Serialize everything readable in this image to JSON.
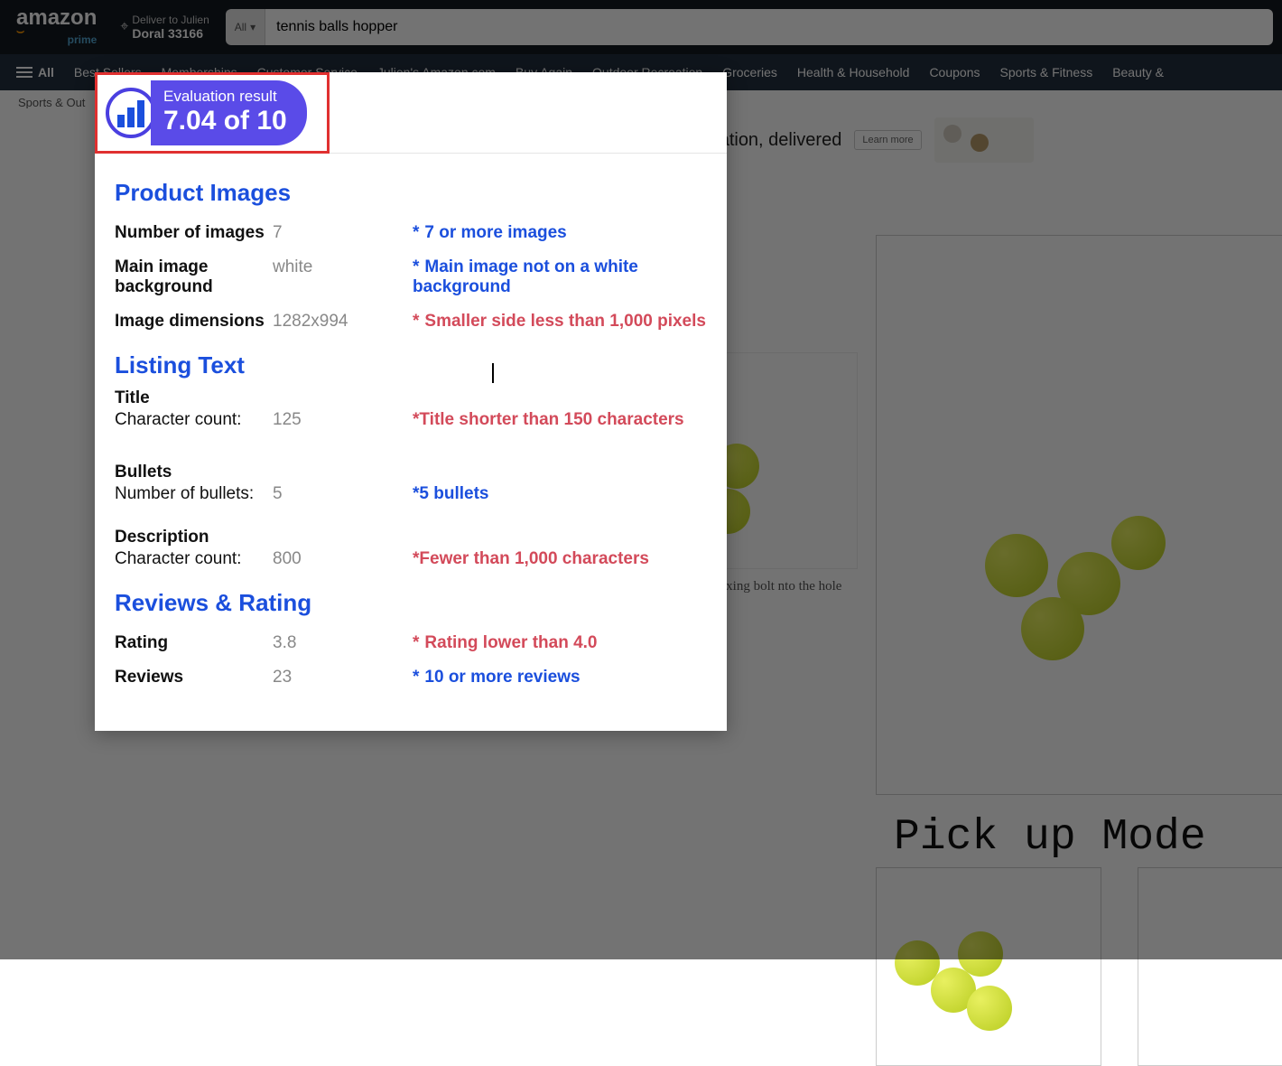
{
  "header": {
    "logo_main": "amazon",
    "logo_sub": "prime",
    "deliver_label": "Deliver to Julien",
    "deliver_loc": "Doral 33166",
    "search_cat": "All",
    "search_value": "tennis balls hopper"
  },
  "nav": {
    "all": "All",
    "items": [
      "Best Sellers",
      "Memberships",
      "Customer Service",
      "Julien's Amazon.com",
      "Buy Again",
      "Outdoor Recreation",
      "Groceries",
      "Health & Household",
      "Coupons",
      "Sports & Fitness",
      "Beauty &"
    ]
  },
  "breadcrumb": "Sports & Out",
  "bg": {
    "banner_text": "ur medication, delivered",
    "banner_cta": "Learn more",
    "caption": "nsert the fixing bolt nto the hole",
    "mode_title": "Pick up Mode"
  },
  "panel": {
    "badge_label": "Evaluation result",
    "badge_score": "7.04 of 10",
    "sections": {
      "images": {
        "title": "Product Images",
        "rows": [
          {
            "label": "Number of images",
            "value": "7",
            "note": "7 or more images",
            "status": "pass"
          },
          {
            "label": "Main image background",
            "value": "white",
            "note": "Main image not on a white background",
            "status": "pass"
          },
          {
            "label": "Image dimensions",
            "value": "1282x994",
            "note": "Smaller side less than 1,000 pixels",
            "status": "fail"
          }
        ]
      },
      "listing": {
        "title": "Listing Text",
        "groups": [
          {
            "head": "Title",
            "label": "Character count:",
            "value": "125",
            "note": "Title shorter than 150 characters",
            "status": "fail"
          },
          {
            "head": "Bullets",
            "label": "Number of bullets:",
            "value": "5",
            "note": "5 bullets",
            "status": "pass"
          },
          {
            "head": "Description",
            "label": "Character count:",
            "value": "800",
            "note": "Fewer than 1,000 characters",
            "status": "fail"
          }
        ]
      },
      "reviews": {
        "title": "Reviews & Rating",
        "rows": [
          {
            "label": "Rating",
            "value": "3.8",
            "note": "Rating lower than 4.0",
            "status": "fail"
          },
          {
            "label": "Reviews",
            "value": "23",
            "note": "10 or more reviews",
            "status": "pass"
          }
        ]
      }
    }
  }
}
